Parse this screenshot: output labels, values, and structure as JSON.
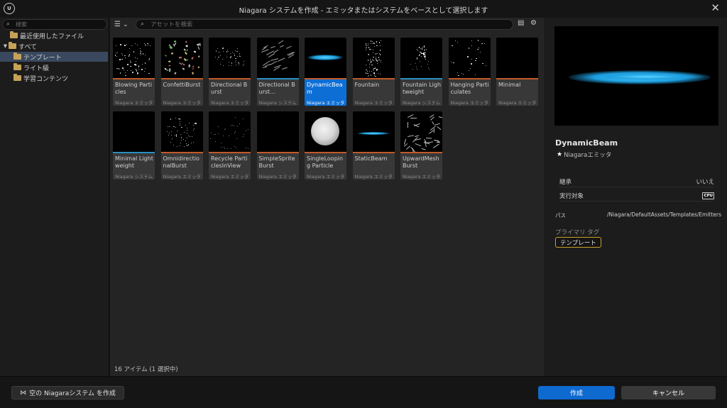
{
  "window": {
    "logo_text": "U",
    "title": "Niagara システムを作成 - エミッタまたはシステムをベースとして選択します",
    "close_glyph": "✕"
  },
  "tree": {
    "search_placeholder": "検索",
    "items": [
      {
        "label": "最近使用したファイル",
        "arrow": ""
      },
      {
        "label": "すべて",
        "arrow": "▼"
      },
      {
        "label": "テンプレート",
        "arrow": "",
        "selected": true
      },
      {
        "label": "ライト級",
        "arrow": ""
      },
      {
        "label": "学習コンテンツ",
        "arrow": ""
      }
    ]
  },
  "assets": {
    "filter_glyph": "☰",
    "filter_arrow": "⌄",
    "search_placeholder": "アセットを検索",
    "tiles": [
      {
        "name": "Blowing Particles",
        "kind": "Niagara エミッタ",
        "type": "emitter",
        "thumb": "dots-left"
      },
      {
        "name": "ConfettiBurst",
        "kind": "Niagara エミッタ",
        "type": "emitter",
        "thumb": "confetti"
      },
      {
        "name": "Directional Burst",
        "kind": "Niagara エミッタ",
        "type": "emitter",
        "thumb": "dots-cluster"
      },
      {
        "name": "Directional Burst...",
        "kind": "Niagara システム",
        "type": "system",
        "thumb": "streaks"
      },
      {
        "name": "DynamicBeam",
        "kind": "Niagara エミッタ",
        "type": "emitter",
        "thumb": "beam",
        "selected": true
      },
      {
        "name": "Fountain",
        "kind": "Niagara エミッタ",
        "type": "emitter",
        "thumb": "fountain"
      },
      {
        "name": "Fountain Lightweight",
        "kind": "Niagara システム",
        "type": "system",
        "thumb": "fountain-lw"
      },
      {
        "name": "Hanging Particulates",
        "kind": "Niagara エミッタ",
        "type": "emitter",
        "thumb": "sparse"
      },
      {
        "name": "Minimal",
        "kind": "Niagara エミッタ",
        "type": "emitter",
        "thumb": "blank"
      },
      {
        "name": "Minimal Lightweight",
        "kind": "Niagara システム",
        "type": "system",
        "thumb": "blank"
      },
      {
        "name": "OmnidirectionalBurst",
        "kind": "Niagara エミッタ",
        "type": "emitter",
        "thumb": "omni"
      },
      {
        "name": "Recycle ParticlesInView",
        "kind": "Niagara エミッタ",
        "type": "emitter",
        "thumb": "recycle"
      },
      {
        "name": "SimpleSprite Burst",
        "kind": "Niagara エミッタ",
        "type": "emitter",
        "thumb": "blank"
      },
      {
        "name": "SingleLooping Particle",
        "kind": "Niagara エミッタ",
        "type": "emitter",
        "thumb": "orb"
      },
      {
        "name": "StaticBeam",
        "kind": "Niagara エミッタ",
        "type": "emitter",
        "thumb": "static-beam"
      },
      {
        "name": "UpwardMesh Burst",
        "kind": "Niagara エミッタ",
        "type": "emitter",
        "thumb": "mesh"
      }
    ],
    "item_count": "16 アイテム (1 選択中)"
  },
  "details": {
    "name": "DynamicBeam",
    "type_label": "Niagaraエミッタ",
    "type_icon": "★",
    "rows": [
      {
        "label": "継承",
        "value": "いいえ"
      },
      {
        "label": "実行対象",
        "value": "CPU"
      }
    ],
    "path_label": "パス",
    "path_value": "/Niagara/DefaultAssets/Templates/Emitters",
    "primary_tag_label": "プライマリ タグ",
    "primary_tag": "テンプレート"
  },
  "buttons": {
    "empty_system": "空の Niagaraシステム を作成",
    "create": "作成",
    "cancel": "キャンセル"
  },
  "colors": {
    "selected_tile": "#0d6fd6",
    "emitter_bar": "#c25a2a",
    "system_bar": "#2a8fc2",
    "tag_border": "#c9a227",
    "beam": "#1d9fe0"
  }
}
